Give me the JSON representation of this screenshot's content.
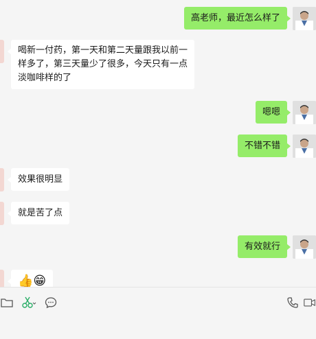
{
  "messages": [
    {
      "side": "out",
      "text": "高老师，最近怎么样了"
    },
    {
      "side": "in",
      "lines": [
        "喝新一付药，第一天和第二天量跟我以前一",
        "样多了，第三天量少了很多，今天只有一点",
        "淡咖啡样的了"
      ]
    },
    {
      "side": "out",
      "text": "嗯嗯"
    },
    {
      "side": "out",
      "text": "不错不错"
    },
    {
      "side": "in",
      "text": "效果很明显"
    },
    {
      "side": "in",
      "text": "就是苦了点"
    },
    {
      "side": "out",
      "text": "有效就行"
    },
    {
      "side": "in",
      "emoji": "👍😁"
    }
  ],
  "toolbar": {
    "icons": [
      "folder-icon",
      "scissors-icon",
      "chat-history-icon",
      "phone-icon",
      "video-call-icon"
    ]
  },
  "colors": {
    "outgoing_bubble": "#95ec69",
    "incoming_bubble": "#ffffff",
    "background": "#f5f5f5",
    "scissors_accent": "#2aae67"
  }
}
